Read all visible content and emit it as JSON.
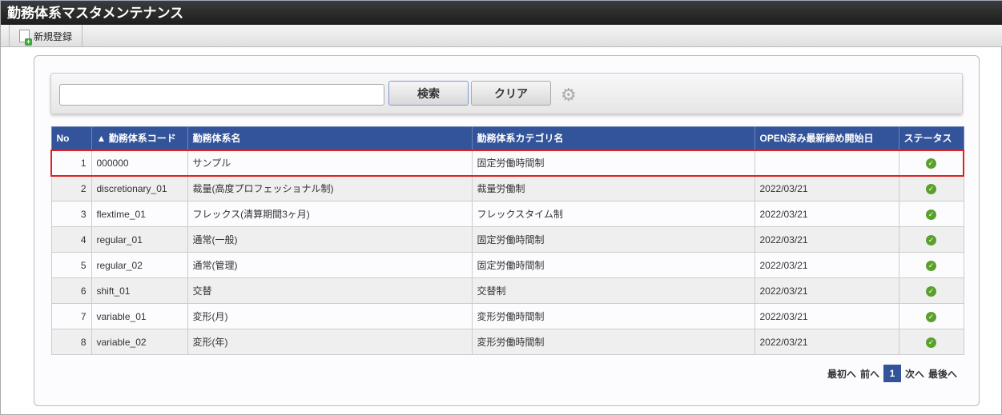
{
  "title": "勤務体系マスタメンテナンス",
  "toolbar": {
    "new_label": "新規登録"
  },
  "search": {
    "value": "",
    "search_label": "検索",
    "clear_label": "クリア"
  },
  "table": {
    "headers": [
      "No",
      "▲ 勤務体系コード",
      "勤務体系名",
      "勤務体系カテゴリ名",
      "OPEN済み最新締め開始日",
      "ステータス"
    ],
    "rows": [
      {
        "no": "1",
        "code": "000000",
        "name": "サンプル",
        "category": "固定労働時間制",
        "date": "",
        "status": "ok"
      },
      {
        "no": "2",
        "code": "discretionary_01",
        "name": "裁量(高度プロフェッショナル制)",
        "category": "裁量労働制",
        "date": "2022/03/21",
        "status": "ok"
      },
      {
        "no": "3",
        "code": "flextime_01",
        "name": "フレックス(清算期間3ヶ月)",
        "category": "フレックスタイム制",
        "date": "2022/03/21",
        "status": "ok"
      },
      {
        "no": "4",
        "code": "regular_01",
        "name": "通常(一般)",
        "category": "固定労働時間制",
        "date": "2022/03/21",
        "status": "ok"
      },
      {
        "no": "5",
        "code": "regular_02",
        "name": "通常(管理)",
        "category": "固定労働時間制",
        "date": "2022/03/21",
        "status": "ok"
      },
      {
        "no": "6",
        "code": "shift_01",
        "name": "交替",
        "category": "交替制",
        "date": "2022/03/21",
        "status": "ok"
      },
      {
        "no": "7",
        "code": "variable_01",
        "name": "変形(月)",
        "category": "変形労働時間制",
        "date": "2022/03/21",
        "status": "ok"
      },
      {
        "no": "8",
        "code": "variable_02",
        "name": "変形(年)",
        "category": "変形労働時間制",
        "date": "2022/03/21",
        "status": "ok"
      }
    ]
  },
  "pager": {
    "first": "最初へ",
    "prev": "前へ",
    "current": "1",
    "next": "次へ",
    "last": "最後へ"
  }
}
